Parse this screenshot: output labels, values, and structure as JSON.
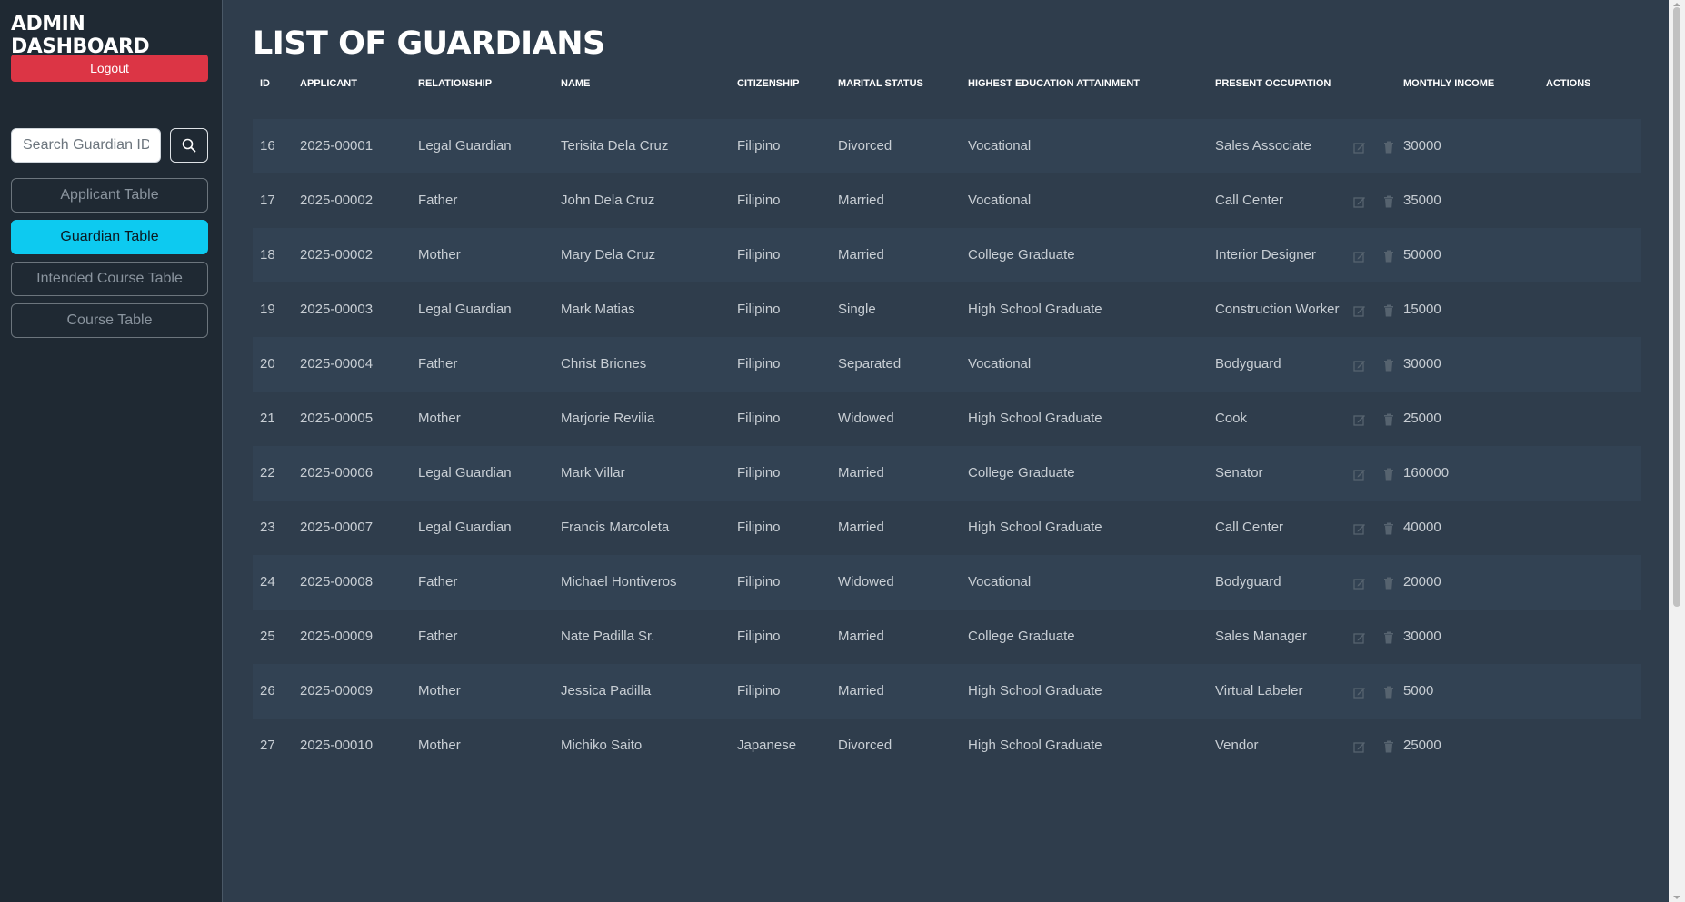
{
  "sidebar": {
    "brand": "ADMIN DASHBOARD",
    "logout_label": "Logout",
    "search_placeholder": "Search Guardian ID...",
    "nav": [
      {
        "label": "Applicant Table",
        "active": false
      },
      {
        "label": "Guardian Table",
        "active": true
      },
      {
        "label": "Intended Course Table",
        "active": false
      },
      {
        "label": "Course Table",
        "active": false
      }
    ]
  },
  "main": {
    "title": "LIST OF GUARDIANS",
    "columns": [
      "ID",
      "APPLICANT",
      "RELATIONSHIP",
      "NAME",
      "CITIZENSHIP",
      "MARITAL STATUS",
      "HIGHEST EDUCATION ATTAINMENT",
      "PRESENT OCCUPATION",
      "MONTHLY INCOME",
      "ACTIONS"
    ],
    "rows": [
      {
        "id": "16",
        "applicant": "2025-00001",
        "relationship": "Legal Guardian",
        "name": "Terisita Dela Cruz",
        "citizenship": "Filipino",
        "marital": "Divorced",
        "education": "Vocational",
        "occupation": "Sales Associate",
        "income": "30000"
      },
      {
        "id": "17",
        "applicant": "2025-00002",
        "relationship": "Father",
        "name": "John Dela Cruz",
        "citizenship": "Filipino",
        "marital": "Married",
        "education": "Vocational",
        "occupation": "Call Center",
        "income": "35000"
      },
      {
        "id": "18",
        "applicant": "2025-00002",
        "relationship": "Mother",
        "name": "Mary Dela Cruz",
        "citizenship": "Filipino",
        "marital": "Married",
        "education": "College Graduate",
        "occupation": "Interior Designer",
        "income": "50000"
      },
      {
        "id": "19",
        "applicant": "2025-00003",
        "relationship": "Legal Guardian",
        "name": "Mark Matias",
        "citizenship": "Filipino",
        "marital": "Single",
        "education": "High School Graduate",
        "occupation": "Construction Worker",
        "income": "15000"
      },
      {
        "id": "20",
        "applicant": "2025-00004",
        "relationship": "Father",
        "name": "Christ Briones",
        "citizenship": "Filipino",
        "marital": "Separated",
        "education": "Vocational",
        "occupation": "Bodyguard",
        "income": "30000"
      },
      {
        "id": "21",
        "applicant": "2025-00005",
        "relationship": "Mother",
        "name": "Marjorie Revilia",
        "citizenship": "Filipino",
        "marital": "Widowed",
        "education": "High School Graduate",
        "occupation": "Cook",
        "income": "25000"
      },
      {
        "id": "22",
        "applicant": "2025-00006",
        "relationship": "Legal Guardian",
        "name": "Mark Villar",
        "citizenship": "Filipino",
        "marital": "Married",
        "education": "College Graduate",
        "occupation": "Senator",
        "income": "160000"
      },
      {
        "id": "23",
        "applicant": "2025-00007",
        "relationship": "Legal Guardian",
        "name": "Francis Marcoleta",
        "citizenship": "Filipino",
        "marital": "Married",
        "education": "High School Graduate",
        "occupation": "Call Center",
        "income": "40000"
      },
      {
        "id": "24",
        "applicant": "2025-00008",
        "relationship": "Father",
        "name": "Michael Hontiveros",
        "citizenship": "Filipino",
        "marital": "Widowed",
        "education": "Vocational",
        "occupation": "Bodyguard",
        "income": "20000"
      },
      {
        "id": "25",
        "applicant": "2025-00009",
        "relationship": "Father",
        "name": "Nate Padilla Sr.",
        "citizenship": "Filipino",
        "marital": "Married",
        "education": "College Graduate",
        "occupation": "Sales Manager",
        "income": "30000"
      },
      {
        "id": "26",
        "applicant": "2025-00009",
        "relationship": "Mother",
        "name": "Jessica Padilla",
        "citizenship": "Filipino",
        "marital": "Married",
        "education": "High School Graduate",
        "occupation": "Virtual Labeler",
        "income": "5000"
      },
      {
        "id": "27",
        "applicant": "2025-00010",
        "relationship": "Mother",
        "name": "Michiko Saito",
        "citizenship": "Japanese",
        "marital": "Divorced",
        "education": "High School Graduate",
        "occupation": "Vendor",
        "income": "25000"
      }
    ],
    "row_actions": {
      "edit_icon": "edit-icon",
      "delete_icon": "trash-icon"
    }
  },
  "colors": {
    "sidebar_bg": "#1f2933",
    "main_bg": "#2f3d4c",
    "danger": "#dc3545",
    "info": "#0dcaf0"
  }
}
